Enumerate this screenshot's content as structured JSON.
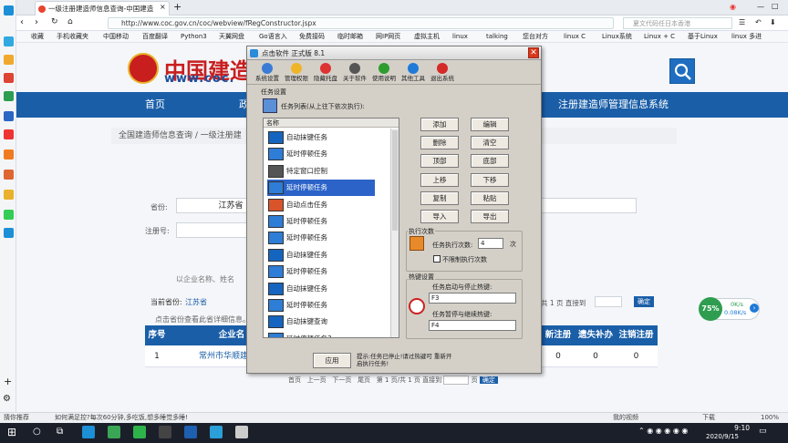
{
  "browser": {
    "tab_title": "一级注册建造师信息查询-中国建造",
    "url": "http://www.coc.gov.cn/coc/webview/fRegConstructor.jspx",
    "search_placeholder": "夏文代码任日本香港",
    "bookmarks": [
      "收藏",
      "手机收藏夹",
      "中国移动",
      "百度翻译",
      "Python3",
      "天翼网盘",
      "Go语言入",
      "免费接码",
      "临时邮箱",
      "网IP网页",
      "虚拟主机",
      "linux",
      "talking",
      "您台对方",
      "linux C",
      "Linux系统",
      "Linux + C",
      "基于Linux",
      "linux 多进"
    ]
  },
  "site": {
    "logo_text": "中国建造",
    "logo_url": "www.coc.",
    "nav": [
      "首页",
      "政",
      "注册建造师管理信息系统"
    ],
    "breadcrumb": "全国建造师信息查询 / 一级注册建",
    "province_label": "省份:",
    "province_value": "江苏省",
    "regno_label": "注册号:",
    "hint_text": "以企业名称、姓名",
    "current_prov_label": "当前省份:",
    "current_prov_value": "江苏省",
    "hint2": "点击省份查看此省详细信息。",
    "pager_right": "共 1 页  直接到",
    "go": "确定",
    "table_headers": [
      "序号",
      "企业名",
      "新注册",
      "遗失补办",
      "注销注册"
    ],
    "table_row": [
      "1",
      "常州市华顺建筑工",
      "0",
      "0",
      "0"
    ],
    "pager_bottom": [
      "首页",
      "上一页",
      "下一页",
      "尾页",
      "第 1 页/共 1 页 直接到",
      "页",
      "确定"
    ]
  },
  "dialog": {
    "title": "点击软件 正式版 8.1",
    "toolbar": [
      {
        "label": "系统设置",
        "icon": "gear-icon",
        "color": "#3a7bd5"
      },
      {
        "label": "管理权限",
        "icon": "hand-icon",
        "color": "#f0b429"
      },
      {
        "label": "隐藏托盘",
        "icon": "download-icon",
        "color": "#d33"
      },
      {
        "label": "关于软件",
        "icon": "user-icon",
        "color": "#555"
      },
      {
        "label": "使用说明",
        "icon": "help-icon",
        "color": "#2e9d2e"
      },
      {
        "label": "其他工具",
        "icon": "globe-icon",
        "color": "#1f7ad8"
      },
      {
        "label": "退出系统",
        "icon": "exit-icon",
        "color": "#d52a2a"
      }
    ],
    "group_task": "任务设置",
    "list_caption": "任务列表(从上往下依次执行):",
    "list_header": "名称",
    "items": [
      "自动抹键任务",
      "延时停顿任务",
      "特定窗口控制",
      "延时停顿任务",
      "自动点击任务",
      "延时停顿任务",
      "延时停顿任务",
      "自动抹键任务",
      "延时停顿任务",
      "自动抹键任务",
      "延时停顿任务",
      "自动抹键查询",
      "延时停顿任务3",
      "自动抹键任务"
    ],
    "selected_index": 3,
    "buttons": [
      [
        "添加",
        "编辑"
      ],
      [
        "删除",
        "清空"
      ],
      [
        "顶部",
        "底部"
      ],
      [
        "上移",
        "下移"
      ],
      [
        "复制",
        "粘贴"
      ],
      [
        "导入",
        "导出"
      ]
    ],
    "exec_group": "执行次数",
    "exec_label": "任务执行次数:",
    "exec_value": "4",
    "exec_unit": "次",
    "unlimited_label": "不限制执行次数",
    "hotkey_group": "热键设置",
    "hotkey1_label": "任务启动与停止热键:",
    "hotkey1_value": "F3",
    "hotkey2_label": "任务暂停与继续热键:",
    "hotkey2_value": "F4",
    "apply": "应用",
    "tip": "提示:任务已停止!请过热键可 重新开启执行任务!"
  },
  "widget": {
    "percent": "75%",
    "up": "0K/s",
    "down": "0.08K/s"
  },
  "statusbar": {
    "left": "猜你推荐",
    "ad": "如何满足控?每次60分钟,多吃饭,想多睡觉多睡!",
    "right": "我的视频",
    "dl": "下载",
    "zoom": "100%"
  },
  "taskbar": {
    "time": "9:10",
    "date": "2020/9/15"
  }
}
